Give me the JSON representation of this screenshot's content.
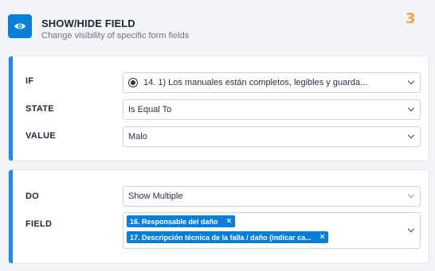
{
  "header": {
    "icon": "eye-icon",
    "title": "SHOW/HIDE FIELD",
    "subtitle": "Change visibility of specific form fields",
    "step": "3",
    "accent_color": "#0a7fd9",
    "step_color": "#f2a33a"
  },
  "condition": {
    "if_label": "IF",
    "if_value": "14. 1) Los manuales están completos, legibles y guarda...",
    "if_icon": "radio-icon",
    "state_label": "STATE",
    "state_value": "Is Equal To",
    "value_label": "VALUE",
    "value_value": "Malo"
  },
  "action": {
    "do_label": "DO",
    "do_value": "Show Multiple",
    "field_label": "FIELD",
    "fields": [
      {
        "label": "16. Responsable del daño",
        "remove": "×"
      },
      {
        "label": "17. Descripción técnica de la falla / daño (indicar ca...",
        "remove": "×"
      }
    ]
  }
}
